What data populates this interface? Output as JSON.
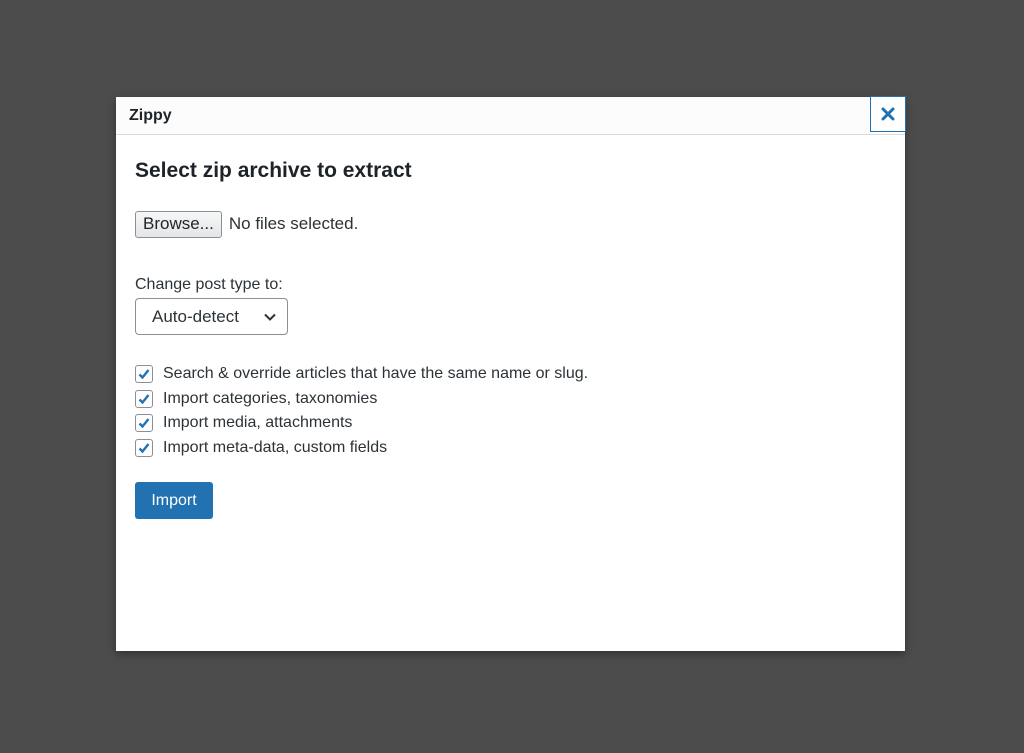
{
  "dialog": {
    "title": "Zippy",
    "heading": "Select zip archive to extract",
    "close_icon": "close-icon"
  },
  "file": {
    "browse_label": "Browse...",
    "status": "No files selected."
  },
  "post_type": {
    "label": "Change post type to:",
    "selected": "Auto-detect"
  },
  "options": [
    {
      "label": "Search & override articles that have the same name or slug.",
      "checked": true
    },
    {
      "label": "Import categories, taxonomies",
      "checked": true
    },
    {
      "label": "Import media, attachments",
      "checked": true
    },
    {
      "label": "Import meta-data, custom fields",
      "checked": true
    }
  ],
  "actions": {
    "import_label": "Import"
  },
  "colors": {
    "accent": "#2271b1",
    "overlay": "#4b4c4b"
  }
}
